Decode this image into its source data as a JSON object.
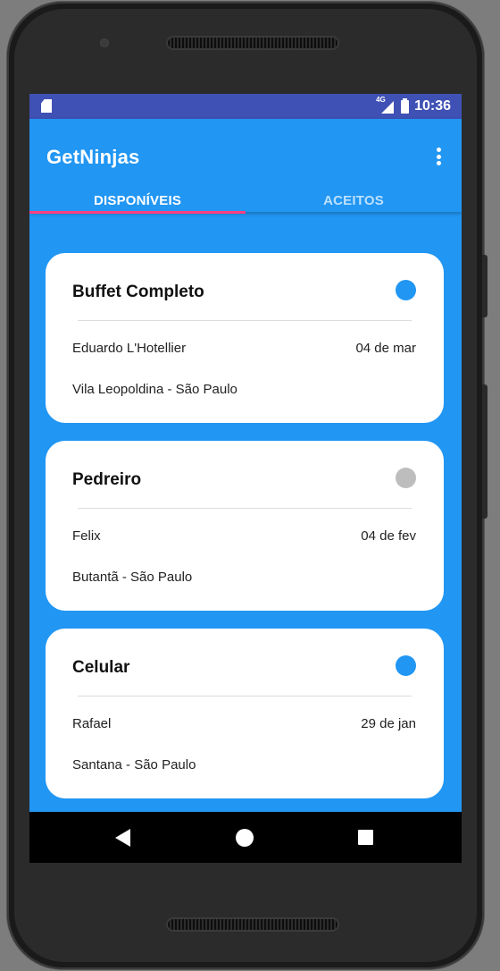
{
  "statusbar": {
    "network_label": "4G",
    "time": "10:36"
  },
  "appbar": {
    "title": "GetNinjas",
    "tabs": [
      {
        "label": "DISPONÍVEIS",
        "active": true
      },
      {
        "label": "ACEITOS",
        "active": false
      }
    ]
  },
  "colors": {
    "primary": "#2196f3",
    "status_bar": "#3f51b5",
    "tab_indicator": "#ff4081",
    "dot_active": "#2196f3",
    "dot_inactive": "#bdbdbd"
  },
  "cards": [
    {
      "title": "Buffet Completo",
      "name": "Eduardo L'Hotellier",
      "date": "04 de mar",
      "location": "Vila Leopoldina - São Paulo",
      "status": "active"
    },
    {
      "title": "Pedreiro",
      "name": "Felix",
      "date": "04 de fev",
      "location": "Butantã - São Paulo",
      "status": "inactive"
    },
    {
      "title": "Celular",
      "name": "Rafael",
      "date": "29 de jan",
      "location": "Santana - São Paulo",
      "status": "active"
    }
  ],
  "navbar": {
    "icons": [
      "back-icon",
      "home-icon",
      "recents-icon"
    ]
  }
}
